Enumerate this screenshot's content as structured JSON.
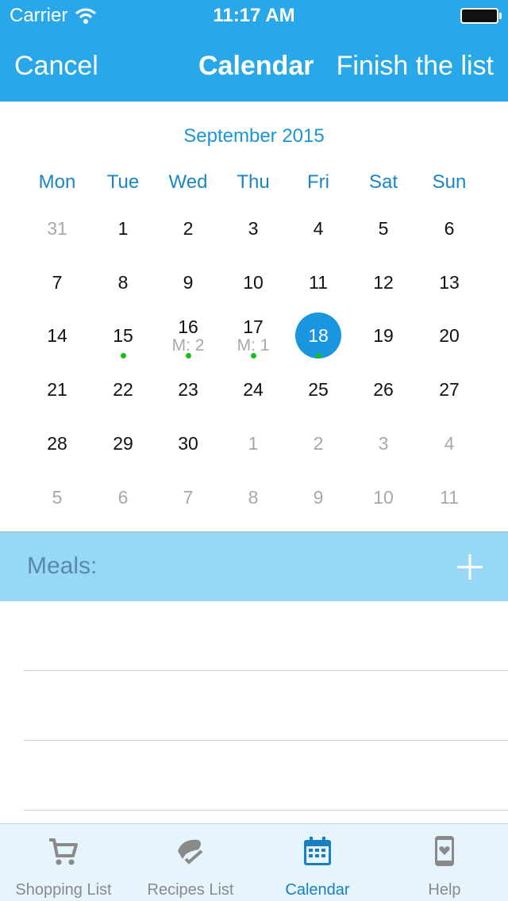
{
  "status_bar": {
    "carrier": "Carrier",
    "time": "11:17 AM"
  },
  "nav": {
    "cancel": "Cancel",
    "title": "Calendar",
    "finish": "Finish the list"
  },
  "calendar": {
    "month_title": "September 2015",
    "weekdays": [
      "Mon",
      "Tue",
      "Wed",
      "Thu",
      "Fri",
      "Sat",
      "Sun"
    ],
    "days": [
      {
        "n": "31",
        "out": true
      },
      {
        "n": "1"
      },
      {
        "n": "2"
      },
      {
        "n": "3"
      },
      {
        "n": "4"
      },
      {
        "n": "5"
      },
      {
        "n": "6"
      },
      {
        "n": "7"
      },
      {
        "n": "8"
      },
      {
        "n": "9"
      },
      {
        "n": "10"
      },
      {
        "n": "11"
      },
      {
        "n": "12"
      },
      {
        "n": "13"
      },
      {
        "n": "14"
      },
      {
        "n": "15",
        "dot": true
      },
      {
        "n": "16",
        "meal": "M: 2",
        "dot": true
      },
      {
        "n": "17",
        "meal": "M: 1",
        "dot": true
      },
      {
        "n": "18",
        "selected": true,
        "dot": true
      },
      {
        "n": "19"
      },
      {
        "n": "20"
      },
      {
        "n": "21"
      },
      {
        "n": "22"
      },
      {
        "n": "23"
      },
      {
        "n": "24"
      },
      {
        "n": "25"
      },
      {
        "n": "26"
      },
      {
        "n": "27"
      },
      {
        "n": "28"
      },
      {
        "n": "29"
      },
      {
        "n": "30"
      },
      {
        "n": "1",
        "out": true
      },
      {
        "n": "2",
        "out": true
      },
      {
        "n": "3",
        "out": true
      },
      {
        "n": "4",
        "out": true
      },
      {
        "n": "5",
        "out": true
      },
      {
        "n": "6",
        "out": true
      },
      {
        "n": "7",
        "out": true
      },
      {
        "n": "8",
        "out": true
      },
      {
        "n": "9",
        "out": true
      },
      {
        "n": "10",
        "out": true
      },
      {
        "n": "11",
        "out": true
      }
    ]
  },
  "meals": {
    "label": "Meals:"
  },
  "tabs": [
    {
      "label": "Shopping List",
      "icon": "cart-icon",
      "active": false
    },
    {
      "label": "Recipes List",
      "icon": "recipes-icon",
      "active": false
    },
    {
      "label": "Calendar",
      "icon": "calendar-icon",
      "active": true
    },
    {
      "label": "Help",
      "icon": "phone-heart-icon",
      "active": false
    }
  ],
  "colors": {
    "header": "#28a8e8",
    "accent": "#1a96e0",
    "meals_bar": "#97d8f6",
    "event_dot": "#18c018",
    "tab_active": "#1a7fc0",
    "tab_inactive": "#8a8a8a"
  }
}
